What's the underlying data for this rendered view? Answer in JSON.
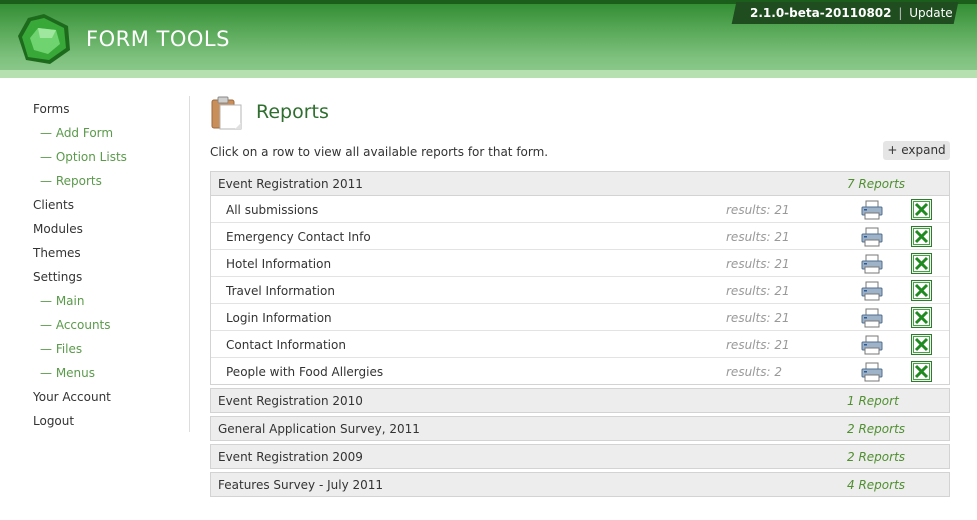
{
  "header": {
    "app_name": "FORM TOOLS",
    "version": "2.1.0-beta-20110802",
    "separator": "|",
    "update_label": "Update"
  },
  "sidebar": {
    "items": [
      {
        "label": "Forms",
        "level": 0
      },
      {
        "label": "— Add Form",
        "level": 1
      },
      {
        "label": "— Option Lists",
        "level": 1
      },
      {
        "label": "— Reports",
        "level": 1
      },
      {
        "label": "Clients",
        "level": 0
      },
      {
        "label": "Modules",
        "level": 0
      },
      {
        "label": "Themes",
        "level": 0
      },
      {
        "label": "Settings",
        "level": 0
      },
      {
        "label": "— Main",
        "level": 1
      },
      {
        "label": "— Accounts",
        "level": 1
      },
      {
        "label": "— Files",
        "level": 1
      },
      {
        "label": "— Menus",
        "level": 1
      },
      {
        "label": "Your Account",
        "level": 0
      },
      {
        "label": "Logout",
        "level": 0
      }
    ]
  },
  "main": {
    "title": "Reports",
    "instructions": "Click on a row to view all available reports for that form.",
    "expand_label": "+ expand",
    "groups": [
      {
        "name": "Event Registration 2011",
        "count": "7 Reports",
        "expanded": true,
        "reports": [
          {
            "name": "All submissions",
            "results": "results: 21"
          },
          {
            "name": "Emergency Contact Info",
            "results": "results: 21"
          },
          {
            "name": "Hotel Information",
            "results": "results: 21"
          },
          {
            "name": "Travel Information",
            "results": "results: 21"
          },
          {
            "name": "Login Information",
            "results": "results: 21"
          },
          {
            "name": "Contact Information",
            "results": "results: 21"
          },
          {
            "name": "People with Food Allergies",
            "results": "results: 2"
          }
        ]
      },
      {
        "name": "Event Registration 2010",
        "count": "1 Report",
        "expanded": false
      },
      {
        "name": "General Application Survey, 2011",
        "count": "2 Reports",
        "expanded": false
      },
      {
        "name": "Event Registration 2009",
        "count": "2 Reports",
        "expanded": false
      },
      {
        "name": "Features Survey - July 2011",
        "count": "4 Reports",
        "expanded": false
      }
    ]
  },
  "icons": {
    "logo": "green-gem-logo-icon",
    "page": "clipboard-icon",
    "print": "printer-icon",
    "export": "excel-icon"
  },
  "colors": {
    "header_green": "#4fa24f",
    "title_green": "#2e6e2e",
    "count_green": "#4f8f2f",
    "sublink_green": "#5a9a4a"
  }
}
